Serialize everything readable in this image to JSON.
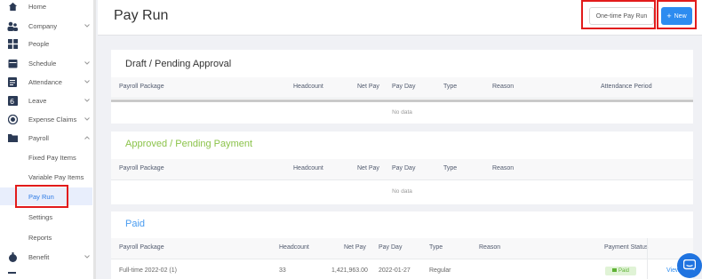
{
  "sidebar": {
    "items": [
      {
        "label": "Home",
        "icon": "home-icon"
      },
      {
        "label": "Company",
        "icon": "company-icon"
      },
      {
        "label": "People",
        "icon": "people-icon"
      },
      {
        "label": "Schedule",
        "icon": "schedule-icon"
      },
      {
        "label": "Attendance",
        "icon": "attendance-icon"
      },
      {
        "label": "Leave",
        "icon": "leave-icon"
      },
      {
        "label": "Expense Claims",
        "icon": "expense-icon"
      },
      {
        "label": "Payroll",
        "icon": "payroll-icon"
      },
      {
        "label": "Fixed Pay Items"
      },
      {
        "label": "Variable Pay Items"
      },
      {
        "label": "Pay Run"
      },
      {
        "label": "Settings"
      },
      {
        "label": "Reports"
      },
      {
        "label": "Benefit",
        "icon": "benefit-icon"
      }
    ]
  },
  "header": {
    "title": "Pay Run",
    "onetime_label": "One-time Pay Run",
    "new_label": "New"
  },
  "draft": {
    "title": "Draft / Pending Approval",
    "columns": [
      "Payroll Package",
      "Headcount",
      "Net Pay",
      "Pay Day",
      "Type",
      "Reason",
      "Attendance Period"
    ],
    "empty_text": "No data"
  },
  "approved": {
    "title": "Approved / Pending Payment",
    "columns": [
      "Payroll Package",
      "Headcount",
      "Net Pay",
      "Pay Day",
      "Type",
      "Reason"
    ],
    "empty_text": "No data"
  },
  "paid": {
    "title": "Paid",
    "columns": [
      "Payroll Package",
      "Headcount",
      "Net Pay",
      "Pay Day",
      "Type",
      "Reason",
      "Payment Status"
    ],
    "rows": [
      {
        "package": "Full-time 2022-02 (1)",
        "headcount": "33",
        "net_pay": "1,421,963.00",
        "pay_day": "2022-01-27",
        "type": "Regular",
        "reason": "",
        "status": "Paid",
        "action": "View"
      }
    ]
  },
  "colors": {
    "accent": "#2d8cf0",
    "highlight": "#e21b1b",
    "approved": "#8bc34a",
    "paid_title": "#4a9cf0"
  }
}
